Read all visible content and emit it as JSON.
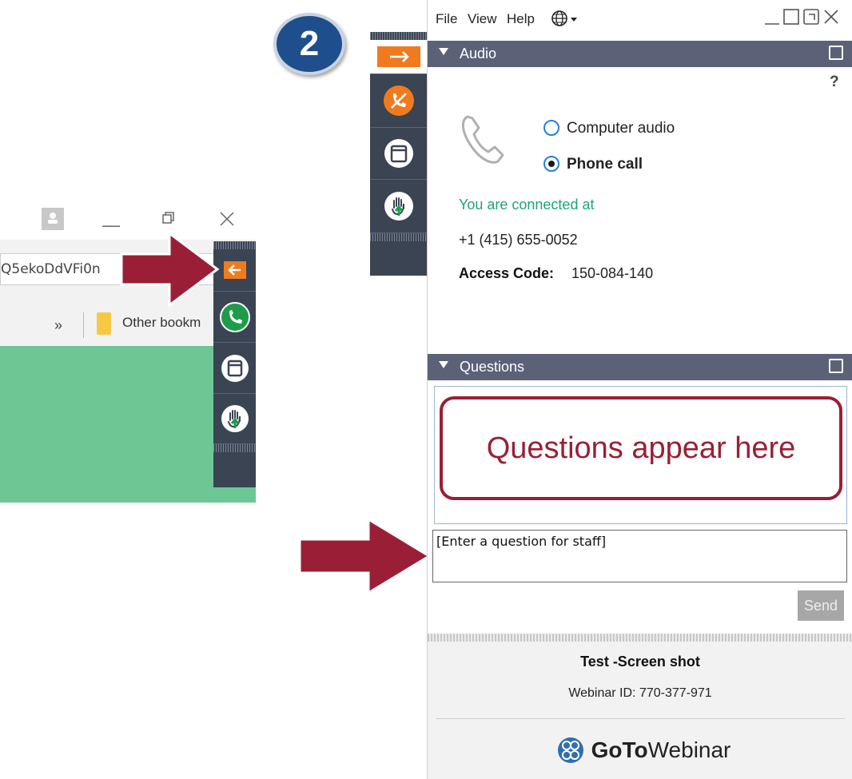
{
  "step_badge": "2",
  "browser": {
    "url_fragment": "Q5ekoDdVFi0n",
    "bookmarks_chevron": "»",
    "bookmark_label": "Other bookm"
  },
  "gotowebinar": {
    "menu": [
      "File",
      "View",
      "Help"
    ],
    "audio": {
      "section_title": "Audio",
      "help": "?",
      "options": [
        {
          "label": "Computer audio",
          "selected": false
        },
        {
          "label": "Phone call",
          "selected": true
        }
      ],
      "connected_text": "You are connected at",
      "phone_number": "+1 (415) 655-0052",
      "access_code_label": "Access Code:",
      "access_code": "150-084-140"
    },
    "questions": {
      "section_title": "Questions",
      "callout": "Questions appear here",
      "input_placeholder": "[Enter a question for staff]",
      "send_label": "Send"
    },
    "footer": {
      "webinar_title": "Test -Screen shot",
      "webinar_id": "Webinar ID: 770-377-971",
      "brand_bold": "GoTo",
      "brand_regular": "Webinar"
    }
  },
  "colors": {
    "header_bar": "#5b6278",
    "dock": "#3b4453",
    "arrow": "#9a1f36",
    "connected_text": "#1aa67a",
    "badge": "#1f4e8c",
    "orange_button": "#f07b1f",
    "green_button": "#1e9c4a"
  },
  "icons": {
    "expand": "arrow-right-icon",
    "collapse": "arrow-left-icon",
    "audio": "phone-mute-icon",
    "phone": "phone-icon",
    "screen": "window-icon",
    "raise_hand": "raise-hand-icon",
    "handset": "handset-icon",
    "language": "globe-icon",
    "logo": "gotowebinar-logo-icon"
  }
}
